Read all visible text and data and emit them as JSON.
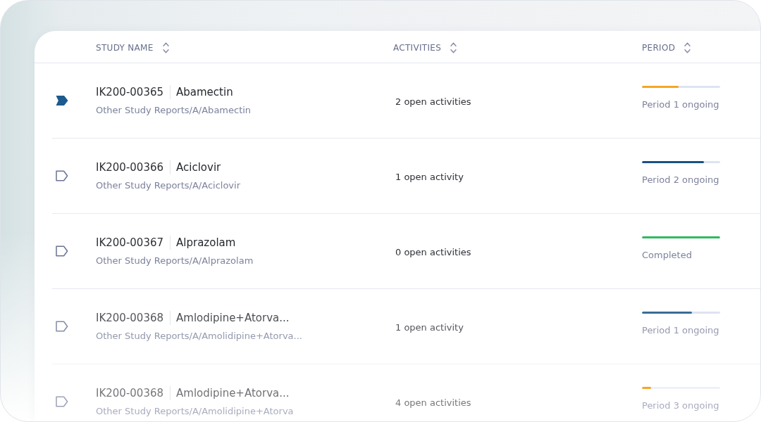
{
  "columns": [
    {
      "label": "STUDY NAME"
    },
    {
      "label": "ACTIVITIES"
    },
    {
      "label": "PERIOD"
    }
  ],
  "rows": [
    {
      "selected": true,
      "study_id": "IK200-00365",
      "name": "Abamectin",
      "path": "Other Study Reports/A/Abamectin",
      "activities": "2 open activities",
      "period": {
        "level": 0.47,
        "color": "#f5a623",
        "label": "Period 1 ongoing"
      }
    },
    {
      "selected": false,
      "study_id": "IK200-00366",
      "name": "Aciclovir",
      "path": "Other Study Reports/A/Aciclovir",
      "activities": "1 open activity",
      "period": {
        "level": 0.79,
        "color": "#1b4f82",
        "label": "Period 2 ongoing"
      }
    },
    {
      "selected": false,
      "study_id": "IK200-00367",
      "name": "Alprazolam",
      "path": "Other Study Reports/A/Alprazolam",
      "activities": "0 open activities",
      "period": {
        "level": 1,
        "color": "#2dbb5d",
        "label": "Completed"
      }
    },
    {
      "selected": false,
      "study_id": "IK200-00368",
      "name": "Amlodipine+Atorva...",
      "path": "Other Study Reports/A/Amolidipine+Atorva...",
      "activities": "1 open activity",
      "period": {
        "level": 0.64,
        "color": "#3b6c98",
        "label": "Period 1 ongoing"
      }
    },
    {
      "selected": false,
      "study_id": "IK200-00368",
      "name": "Amlodipine+Atorva...",
      "path": "Other Study Reports/A/Amolidipine+Atorva",
      "activities": "4 open activities",
      "period": {
        "level": 0.12,
        "color": "#f5a623",
        "label": "Period 3 ongoing"
      }
    }
  ]
}
